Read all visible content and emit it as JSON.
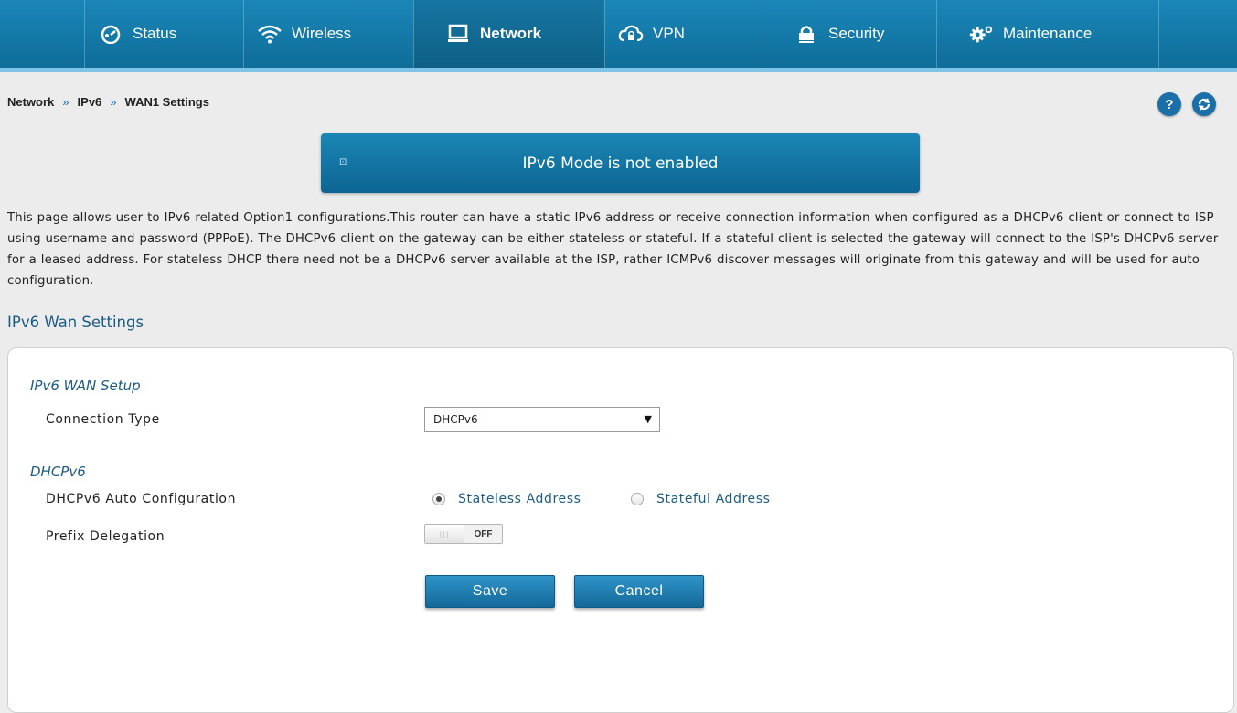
{
  "nav": {
    "items": [
      {
        "label": "Status",
        "icon": "speedometer-icon"
      },
      {
        "label": "Wireless",
        "icon": "wifi-icon"
      },
      {
        "label": "Network",
        "icon": "monitor-icon"
      },
      {
        "label": "VPN",
        "icon": "cloud-lock-icon"
      },
      {
        "label": "Security",
        "icon": "lock-icon"
      },
      {
        "label": "Maintenance",
        "icon": "gears-icon"
      }
    ],
    "active": "Network"
  },
  "breadcrumb": {
    "items": [
      "Network",
      "IPv6",
      "WAN1 Settings"
    ],
    "separator": "»"
  },
  "banner": {
    "text": "IPv6 Mode is not enabled"
  },
  "description": "This page allows user to IPv6 related Option1 configurations.This router can have a static IPv6 address or receive connection information when configured as a DHCPv6 client or connect to ISP using username and password (PPPoE). The DHCPv6 client on the gateway can be either stateless or stateful. If a stateful client is selected the gateway will connect to the ISP's DHCPv6 server for a leased address. For stateless DHCP there need not be a DHCPv6 server available at the ISP, rather ICMPv6 discover messages will originate from this gateway and will be used for auto configuration.",
  "section_title": "IPv6 Wan Settings",
  "form": {
    "setup_title": "IPv6 WAN Setup",
    "connection_type_label": "Connection Type",
    "connection_type_value": "DHCPv6",
    "dhcp_title": "DHCPv6",
    "auto_config_label": "DHCPv6 Auto Configuration",
    "auto_config_options": [
      "Stateless Address",
      "Stateful Address"
    ],
    "auto_config_selected": "Stateless Address",
    "prefix_label": "Prefix Delegation",
    "prefix_state": "OFF",
    "save_label": "Save",
    "cancel_label": "Cancel"
  },
  "colors": {
    "nav_bg": "#1a87b8",
    "accent": "#1b5c84",
    "button": "#1f7fb5"
  }
}
